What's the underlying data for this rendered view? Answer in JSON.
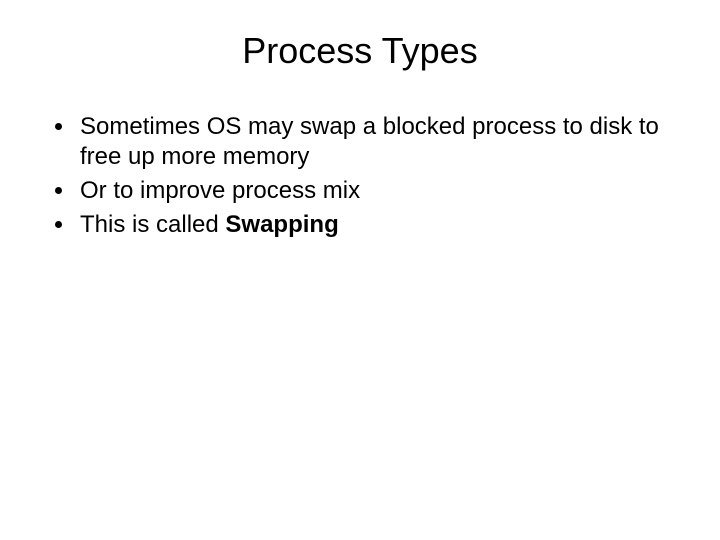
{
  "slide": {
    "title": "Process Types",
    "bullets": [
      {
        "text": "Sometimes OS may swap a blocked process to disk to free up more memory"
      },
      {
        "text": "Or to improve process mix"
      },
      {
        "prefix": "This is called ",
        "bold": "Swapping"
      }
    ]
  }
}
